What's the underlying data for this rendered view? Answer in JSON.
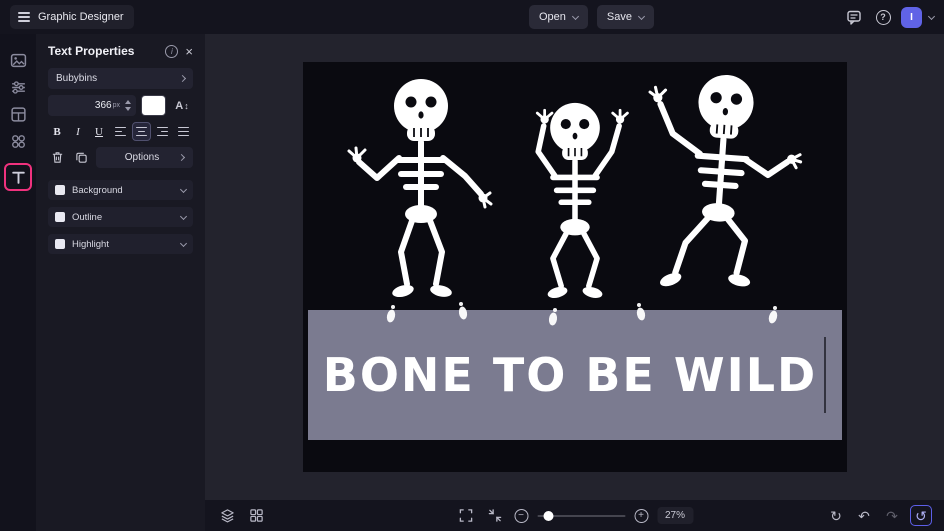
{
  "topbar": {
    "app_title": "Graphic Designer",
    "open_label": "Open",
    "save_label": "Save",
    "help_glyph": "?",
    "info_glyph": "i",
    "avatar_initial": "I"
  },
  "panel": {
    "title": "Text Properties",
    "close_glyph": "×",
    "font_name": "Bubybins",
    "font_size": "366",
    "font_size_unit": "px",
    "letter_icon_glyph": "A",
    "letter_icon_arrows": "↕",
    "bold_label": "B",
    "italic_label": "I",
    "underline_label": "U",
    "options_label": "Options",
    "sections": [
      {
        "label": "Background"
      },
      {
        "label": "Outline"
      },
      {
        "label": "Highlight"
      }
    ]
  },
  "canvas": {
    "headline": "BONE TO BE WILD"
  },
  "bottombar": {
    "zoom_level": "27%",
    "zoom_out_glyph": "−",
    "zoom_in_glyph": "+",
    "refresh_glyph": "↻",
    "undo_glyph": "↶",
    "redo_glyph": "↷",
    "history_glyph": "↺"
  },
  "colors": {
    "accent_pink": "#f0327e",
    "avatar_purple": "#6063e6",
    "band_gray": "#7b7b90",
    "artboard_black": "#0a0a10",
    "panel_bg": "#191923",
    "topbar_bg": "#14141e"
  }
}
